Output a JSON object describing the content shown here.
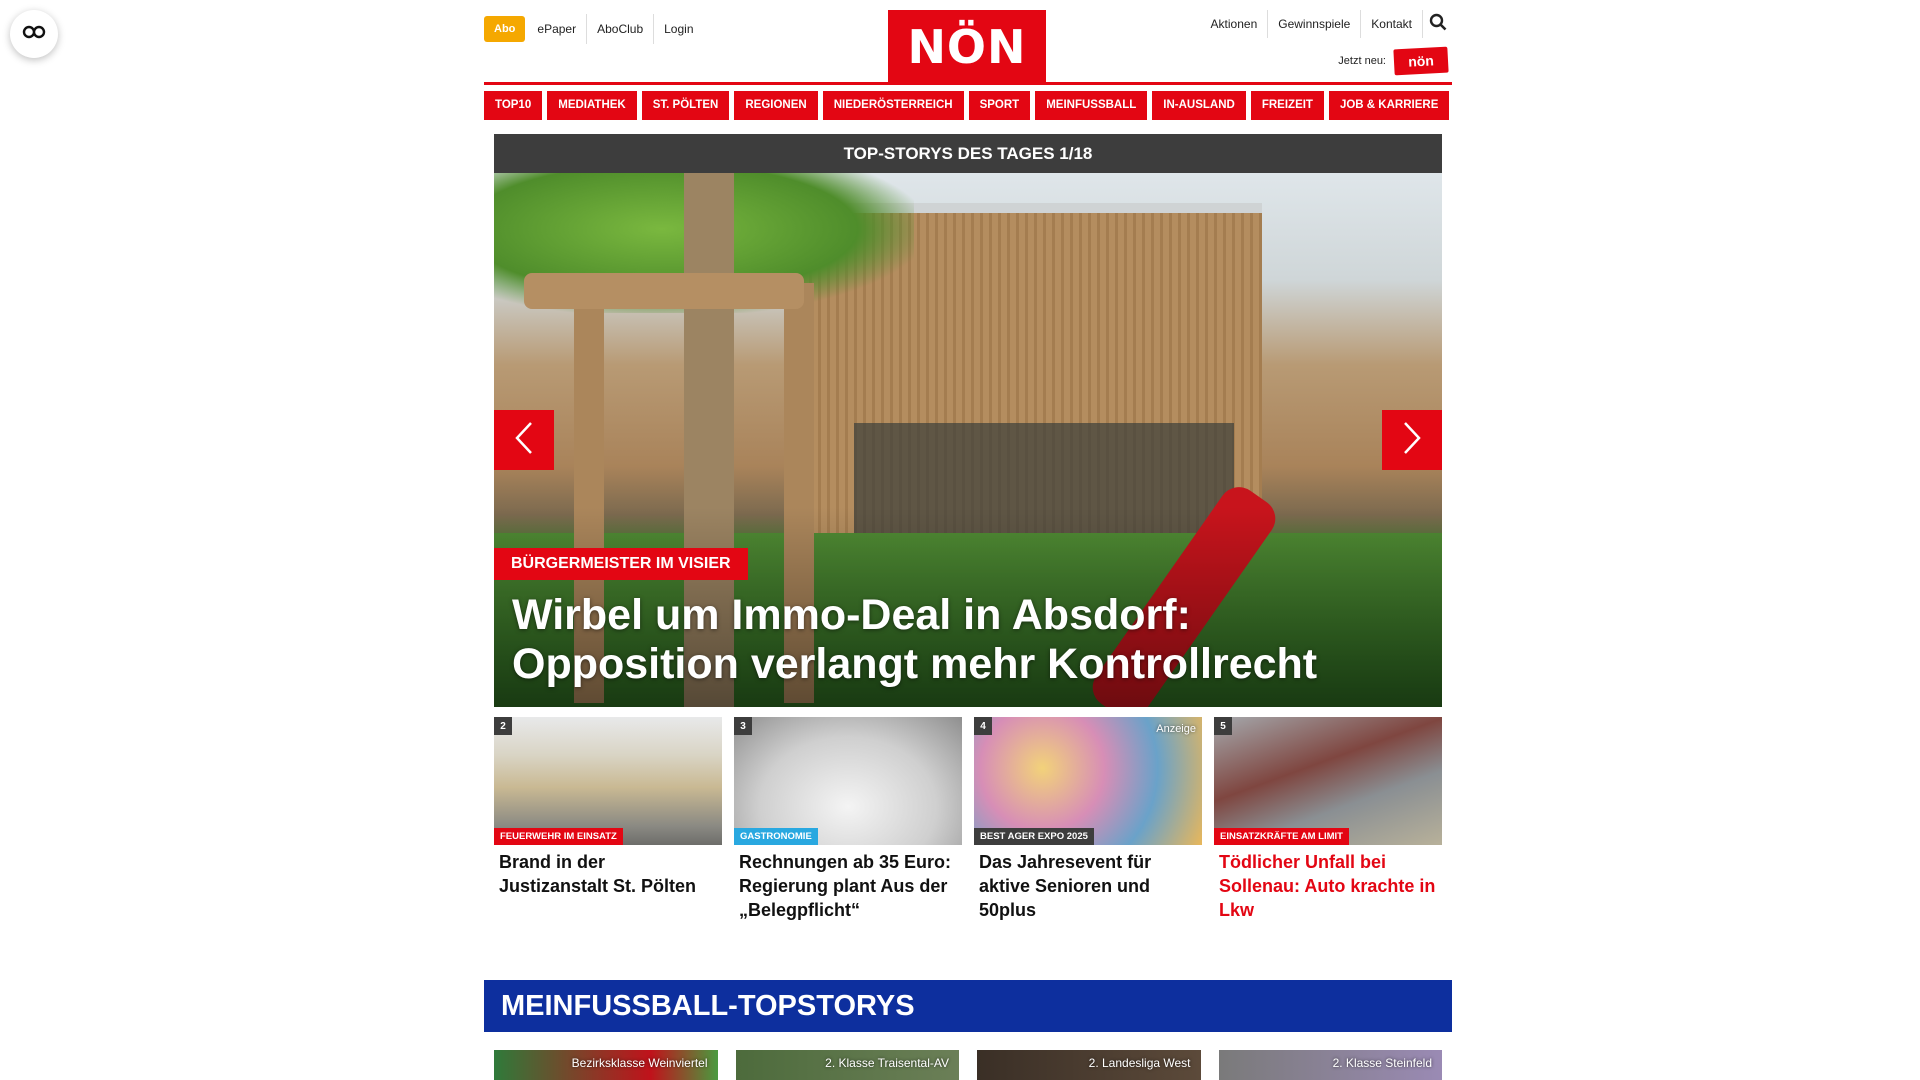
{
  "header": {
    "abo_label": "Abo",
    "top_links": [
      "ePaper",
      "AboClub",
      "Login"
    ],
    "logo_text": "NÖN",
    "right_links": [
      "Aktionen",
      "Gewinnspiele",
      "Kontakt"
    ],
    "jetzt_label": "Jetzt neu:",
    "mini_logo_text": "nön"
  },
  "nav": {
    "items": [
      "TOP10",
      "MEDIATHEK",
      "ST. PÖLTEN",
      "REGIONEN",
      "NIEDERÖSTERREICH",
      "SPORT",
      "MEINFUSSBALL",
      "IN-AUSLAND",
      "FREIZEIT",
      "JOB & KARRIERE"
    ]
  },
  "top_stories": {
    "bar_label": "TOP-STORYS DES TAGES 1/18",
    "hero": {
      "kicker": "BÜRGERMEISTER IM VISIER",
      "title": "Wirbel um Immo-Deal in Absdorf: Opposition verlangt mehr Kontrollrecht"
    },
    "teasers": [
      {
        "num": "2",
        "kicker": "FEUERWEHR IM EINSATZ",
        "kicker_color": "#e30613",
        "title": "Brand in der Justizanstalt St. Pölten",
        "ad": ""
      },
      {
        "num": "3",
        "kicker": "GASTRONOMIE",
        "kicker_color": "#29a8e0",
        "title": "Rechnungen ab 35 Euro: Regierung plant Aus der „Belegpflicht“",
        "ad": ""
      },
      {
        "num": "4",
        "kicker": "BEST AGER EXPO 2025",
        "kicker_color": "#3d3d3d",
        "title": "Das Jahresevent für aktive Senioren und 50plus",
        "ad": "Anzeige"
      },
      {
        "num": "5",
        "kicker": "EINSATZKRÄFTE AM LIMIT",
        "kicker_color": "#e30613",
        "title": "Tödlicher Unfall bei Sollenau: Auto krachte in Lkw",
        "ad": ""
      }
    ]
  },
  "fussball": {
    "title": "MEINFUSSBALL-TOPSTORYS",
    "teasers": [
      "Bezirksklasse Weinviertel",
      "2. Klasse Traisental-AV",
      "2. Landesliga West",
      "2. Klasse Steinfeld"
    ]
  },
  "colors": {
    "brand_red": "#e30613",
    "abo_orange": "#f5a800",
    "fussball_blue": "#0d2f9e",
    "dark_bar": "#3d3d3d"
  }
}
